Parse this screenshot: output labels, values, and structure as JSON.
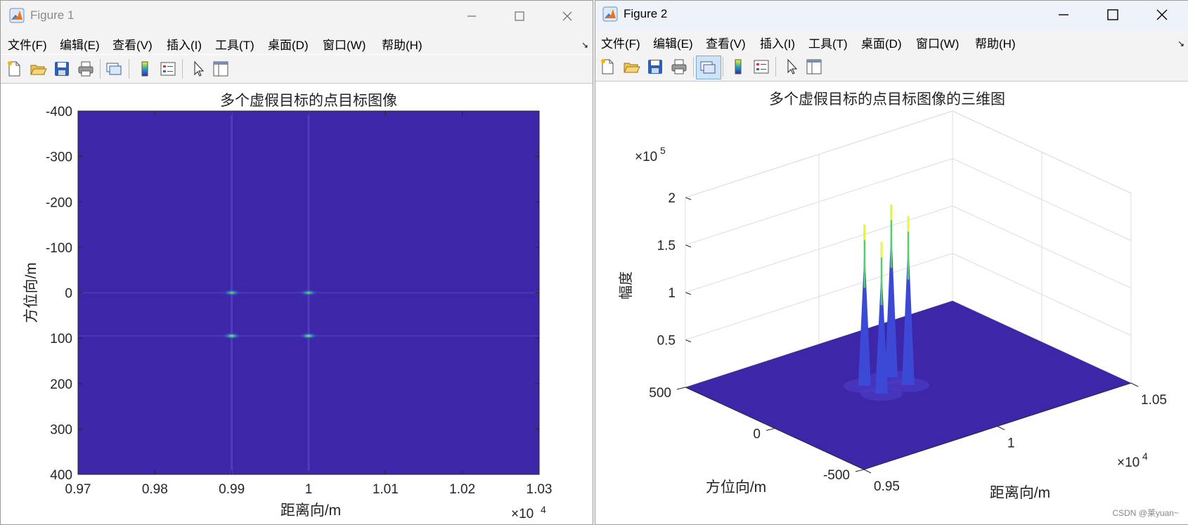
{
  "colors": {
    "parula_low": "#3d26a8",
    "parula_mid": "#1fa5c7",
    "parula_high": "#f9fb0e",
    "accent_peak": "#4fd16a"
  },
  "figure1": {
    "title": "Figure 1",
    "menu": [
      "文件(F)",
      "编辑(E)",
      "查看(V)",
      "插入(I)",
      "工具(T)",
      "桌面(D)",
      "窗口(W)",
      "帮助(H)"
    ],
    "toolbar_icons": [
      "new-figure-icon",
      "open-file-icon",
      "save-icon",
      "print-icon",
      "link-icon",
      "colorbar-icon",
      "legend-icon",
      "pointer-icon",
      "property-inspector-icon"
    ]
  },
  "figure2": {
    "title": "Figure 2",
    "menu": [
      "文件(F)",
      "编辑(E)",
      "查看(V)",
      "插入(I)",
      "工具(T)",
      "桌面(D)",
      "窗口(W)",
      "帮助(H)"
    ],
    "toolbar_icons": [
      "new-figure-icon",
      "open-file-icon",
      "save-icon",
      "print-icon",
      "link-icon",
      "colorbar-icon",
      "legend-icon",
      "pointer-icon",
      "property-inspector-icon"
    ]
  },
  "chart_data": [
    {
      "type": "heatmap",
      "title": "多个虚假目标的点目标图像",
      "xlabel": "距离向/m",
      "ylabel": "方位向/m",
      "x_ticks": [
        "0.97",
        "0.98",
        "0.99",
        "1",
        "1.01",
        "1.02",
        "1.03"
      ],
      "x_tick_values": [
        9700,
        9800,
        9900,
        10000,
        10100,
        10200,
        10300
      ],
      "x_exponent": "×10",
      "x_exponent_power": "4",
      "y_ticks": [
        "-400",
        "-300",
        "-200",
        "-100",
        "0",
        "100",
        "200",
        "300",
        "400"
      ],
      "y_tick_values": [
        -400,
        -300,
        -200,
        -100,
        0,
        100,
        200,
        300,
        400
      ],
      "xlim": [
        9700,
        10300
      ],
      "ylim": [
        -400,
        400
      ],
      "y_reversed": true,
      "points": [
        {
          "x": 9900,
          "y": 0,
          "intensity": 0.7
        },
        {
          "x": 10000,
          "y": 0,
          "intensity": 0.7
        },
        {
          "x": 9900,
          "y": 95,
          "intensity": 0.85
        },
        {
          "x": 10000,
          "y": 95,
          "intensity": 0.85
        }
      ]
    },
    {
      "type": "surface",
      "title": "多个虚假目标的点目标图像的三维图",
      "xlabel": "距离向/m",
      "ylabel": "方位向/m",
      "zlabel": "幅度",
      "x_ticks": [
        "0.95",
        "1",
        "1.05"
      ],
      "x_tick_values": [
        9500,
        10000,
        10500
      ],
      "x_exponent": "×10",
      "x_exponent_power": "4",
      "y_ticks": [
        "500",
        "0",
        "-500"
      ],
      "y_tick_values": [
        500,
        0,
        -500
      ],
      "z_ticks": [
        "0.5",
        "1",
        "1.5",
        "2"
      ],
      "z_tick_values": [
        50000,
        100000,
        150000,
        200000
      ],
      "z_exponent": "×10",
      "z_exponent_power": "5",
      "xlim": [
        9500,
        10500
      ],
      "ylim": [
        -500,
        500
      ],
      "zlim": [
        0,
        200000
      ],
      "peaks": [
        {
          "x": 9900,
          "y": 0,
          "z": 160000
        },
        {
          "x": 10000,
          "y": 0,
          "z": 178000
        },
        {
          "x": 9900,
          "y": 95,
          "z": 170000
        },
        {
          "x": 10000,
          "y": 95,
          "z": 182000
        }
      ]
    }
  ],
  "watermark": "CSDN @莱yuan~"
}
